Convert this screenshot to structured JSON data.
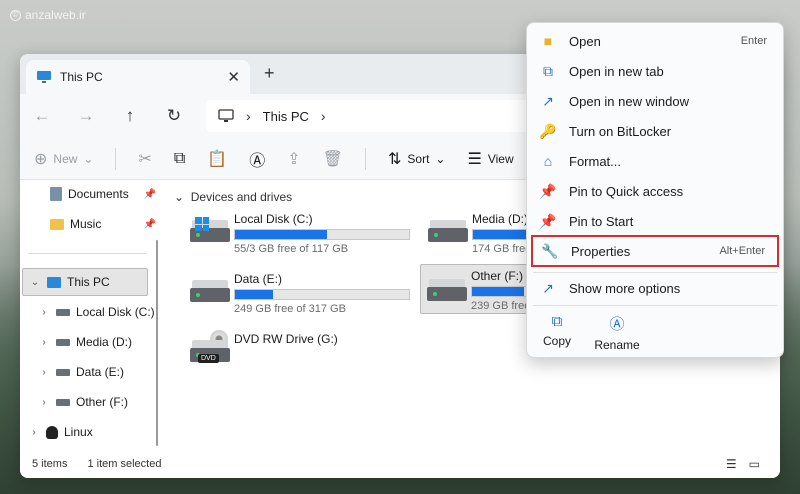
{
  "watermark": {
    "text": "anzalweb.ir",
    "icon": "copyright-icon"
  },
  "tab": {
    "title": "This PC",
    "close_icon": "close-icon",
    "new_icon": "plus-icon"
  },
  "nav": {
    "back": "←",
    "forward": "→",
    "up": "↑",
    "refresh": "↻",
    "crumb": "This PC",
    "sep": "›"
  },
  "toolbar": {
    "new_label": "New",
    "sort_label": "Sort",
    "view_label": "View"
  },
  "sidebar": {
    "items": [
      {
        "label": "Documents",
        "pinned": true
      },
      {
        "label": "Music",
        "pinned": true
      },
      {
        "label": "This PC"
      },
      {
        "label": "Local Disk (C:)"
      },
      {
        "label": "Media (D:)"
      },
      {
        "label": "Data (E:)"
      },
      {
        "label": "Other (F:)"
      },
      {
        "label": "Linux"
      }
    ]
  },
  "main": {
    "group_header": "Devices and drives",
    "drives": [
      {
        "name": "Local Disk (C:)",
        "free": "55/3 GB free of 117 GB",
        "used_fraction": 0.53
      },
      {
        "name": "Media (D:)",
        "free": "174 GB free",
        "used_fraction": 0.4
      },
      {
        "name": "Data (E:)",
        "free": "249 GB free of 317 GB",
        "used_fraction": 0.22
      },
      {
        "name": "Other (F:)",
        "free": "239 GB free",
        "used_fraction": 0.3
      },
      {
        "name": "DVD RW Drive (G:)",
        "tag": "DVD"
      }
    ]
  },
  "status": {
    "count": "5 items",
    "selected": "1 item selected"
  },
  "context_menu": {
    "items": [
      {
        "label": "Open",
        "shortcut": "Enter",
        "icon": "folder-icon"
      },
      {
        "label": "Open in new tab",
        "shortcut": "",
        "icon": "new-tab-icon"
      },
      {
        "label": "Open in new window",
        "shortcut": "",
        "icon": "new-window-icon"
      },
      {
        "label": "Turn on BitLocker",
        "shortcut": "",
        "icon": "bitlocker-icon"
      },
      {
        "label": "Format...",
        "shortcut": "",
        "icon": "format-icon"
      },
      {
        "label": "Pin to Quick access",
        "shortcut": "",
        "icon": "pin-icon"
      },
      {
        "label": "Pin to Start",
        "shortcut": "",
        "icon": "pin-icon"
      },
      {
        "label": "Properties",
        "shortcut": "Alt+Enter",
        "icon": "wrench-icon"
      },
      {
        "label": "Show more options",
        "shortcut": "",
        "icon": "more-options-icon"
      }
    ],
    "actions": [
      {
        "label": "Copy",
        "icon": "copy-icon"
      },
      {
        "label": "Rename",
        "icon": "rename-icon"
      }
    ]
  }
}
